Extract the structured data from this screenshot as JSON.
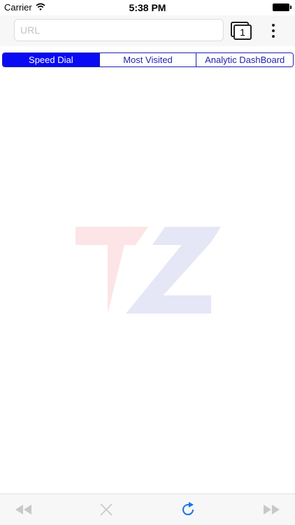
{
  "status_bar": {
    "carrier": "Carrier",
    "time": "5:38 PM",
    "wifi_icon": "wifi-icon",
    "battery_icon": "battery-icon"
  },
  "toolbar": {
    "url_placeholder": "URL",
    "url_value": "",
    "tab_count": "1",
    "tabs_icon": "tabs-icon",
    "more_icon": "more-vertical-icon"
  },
  "segments": {
    "items": [
      {
        "label": "Speed Dial",
        "selected": true
      },
      {
        "label": "Most Visited",
        "selected": false
      },
      {
        "label": "Analytic DashBoard",
        "selected": false
      }
    ]
  },
  "logo": {
    "text": "TZ",
    "colors": {
      "t": "#fde4e6",
      "z": "#e5e6f6"
    }
  },
  "bottom_bar": {
    "back_icon": "rewind-icon",
    "stop_icon": "close-icon",
    "reload_icon": "reload-icon",
    "forward_icon": "fast-forward-icon"
  },
  "colors": {
    "accent": "#1f1fb0",
    "segment_selected_bg": "#0a0af5",
    "reload": "#1a73e8",
    "disabled_icon": "#c8c8c8"
  }
}
